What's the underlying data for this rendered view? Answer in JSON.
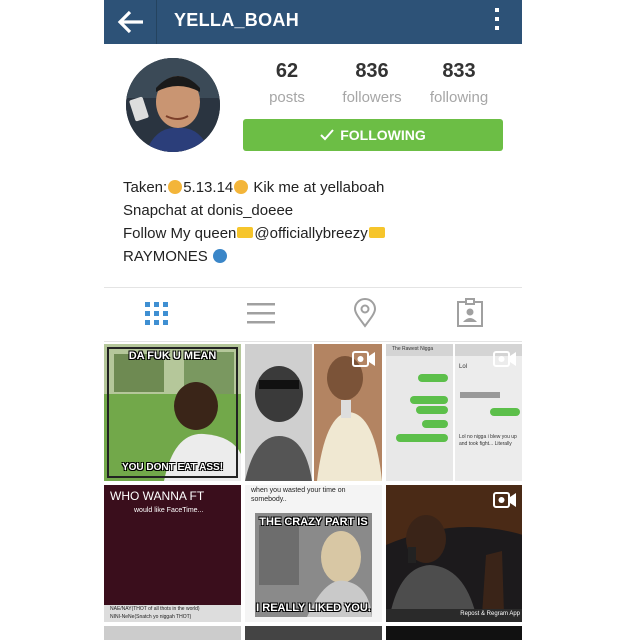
{
  "header": {
    "username": "YELLA_BOAH",
    "back_icon": "back-arrow-icon",
    "menu_icon": "more-vertical-icon",
    "bar_color": "#2d5277"
  },
  "profile": {
    "stats": [
      {
        "value": "62",
        "label": "posts"
      },
      {
        "value": "836",
        "label": "followers"
      },
      {
        "value": "833",
        "label": "following"
      }
    ],
    "follow_button": "FOLLOWING",
    "follow_button_color": "#6cbe45"
  },
  "bio": {
    "line1_a": "Taken:",
    "line1_b": "5.13.14",
    "line1_c": " Kik me at yellaboah",
    "line2": "Snapchat at donis_doeee",
    "line3_a": "Follow My queen",
    "line3_b": "@officiallybreezy",
    "line4": "RAYMONES"
  },
  "tabs": [
    {
      "icon": "grid-view-icon",
      "active": true
    },
    {
      "icon": "list-view-icon",
      "active": false
    },
    {
      "icon": "location-pin-icon",
      "active": false
    },
    {
      "icon": "tagged-photos-icon",
      "active": false
    }
  ],
  "posts": {
    "post1": {
      "top": "DA FUK U MEAN",
      "bottom": "YOU DONT EAT ASS!"
    },
    "post3": {
      "header": "The Rawest Nigga",
      "text1": "Lol no nigga i blew you up and took fight... Literally",
      "text2": "Lol"
    },
    "post4": {
      "title": "WHO WANNA FT",
      "sub": "would like FaceTime...",
      "footer1": "NAE/NAY(THOT of all thots in the world)",
      "footer2": "NINI-NeNe(Snatch yo niggah THOT)"
    },
    "post5": {
      "top": "when you wasted your time on somebody..",
      "mid": "THE CRAZY PART IS",
      "bottom": "I REALLY LIKED YOU."
    },
    "post6": {
      "footer": "Repost & Regram App"
    }
  }
}
